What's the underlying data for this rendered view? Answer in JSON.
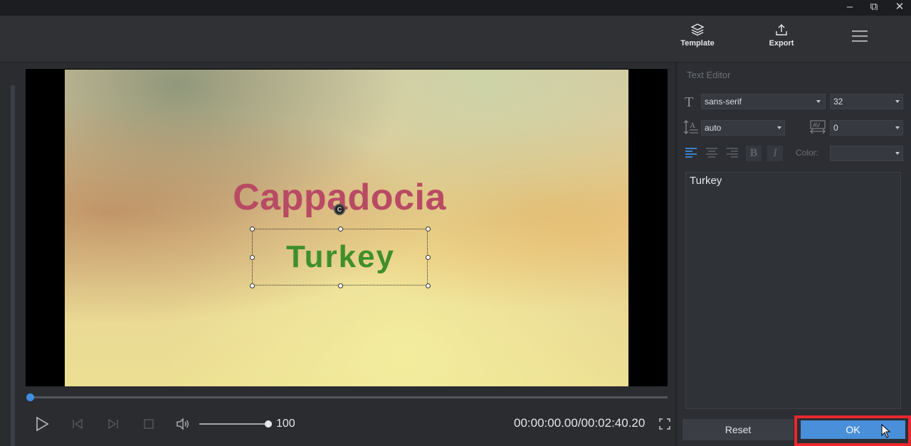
{
  "window": {
    "minimize_glyph": "–",
    "restore_glyph": "⧉",
    "close_glyph": "✕"
  },
  "toolbar": {
    "template_label": "Template",
    "export_label": "Export",
    "template_icon": "layers-icon",
    "export_icon": "upload-icon",
    "menu_icon": "hamburger-menu-icon"
  },
  "preview": {
    "title_text": "Cappadocia",
    "subtitle_text": "Turkey",
    "rotate_glyph": "C",
    "progress": 0.0
  },
  "controls": {
    "volume": "100",
    "volume_level": 1.0,
    "timecode": "00:00:00.00/00:02:40.20"
  },
  "text_editor": {
    "title": "Text Editor",
    "font_family": "sans-serif",
    "font_size": "32",
    "line_spacing": "auto",
    "letter_spacing": "0",
    "bold_glyph": "B",
    "italic_glyph": "I",
    "color_label": "Color:",
    "text_content": "Turkey",
    "reset_label": "Reset",
    "ok_label": "OK"
  },
  "colors": {
    "accent": "#4a8fd9",
    "highlight_outline": "#e8282c",
    "title_text_color": "#b84a64",
    "subtitle_text_color": "#3f8f2c"
  }
}
